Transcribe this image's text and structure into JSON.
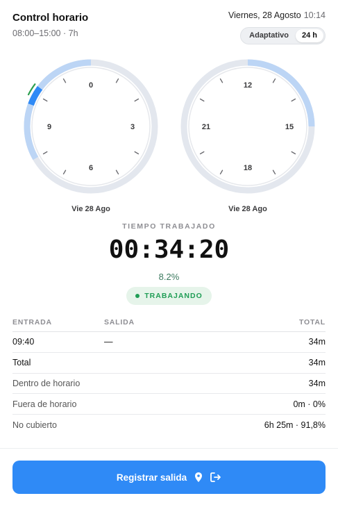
{
  "header": {
    "title": "Control horario",
    "subtitle": "08:00–15:00 · 7h",
    "date": "Viernes, 28 Agosto",
    "time": "10:14",
    "mode_options": [
      "Adaptativo",
      "24 h"
    ],
    "mode_selected": "24 h"
  },
  "clocks": [
    {
      "caption": "Vie 28 Ago",
      "labels": [
        "0",
        "3",
        "6",
        "9"
      ],
      "schedule": [
        "08:00",
        "15:00"
      ],
      "worked": [
        "09:40",
        "10:14"
      ]
    },
    {
      "caption": "Vie 28 Ago",
      "labels": [
        "12",
        "15",
        "18",
        "21"
      ],
      "schedule": [
        "08:00",
        "15:00"
      ]
    }
  ],
  "summary": {
    "label": "TIEMPO TRABAJADO",
    "timer": "00:34:20",
    "percent": "8.2%",
    "status": "TRABAJANDO"
  },
  "table": {
    "headers": [
      "ENTRADA",
      "SALIDA",
      "TOTAL"
    ],
    "entries": [
      {
        "entrada": "09:40",
        "salida": "—",
        "total": "34m"
      }
    ],
    "totals": [
      {
        "label": "Total",
        "value": "34m"
      },
      {
        "label": "Dentro de horario",
        "value": "34m"
      },
      {
        "label": "Fuera de horario",
        "value": "0m · 0%"
      },
      {
        "label": "No cubierto",
        "value": "6h 25m · 91,8%"
      }
    ]
  },
  "action": {
    "label": "Registrar salida",
    "icons": [
      "location-pin-icon",
      "logout-icon"
    ]
  },
  "colors": {
    "accent": "#2f8af6",
    "ring_track": "#e3e7ee",
    "schedule_arc": "#bcd5f5",
    "worked_arc": "#2f8af6",
    "status_green": "#1f9d55"
  }
}
